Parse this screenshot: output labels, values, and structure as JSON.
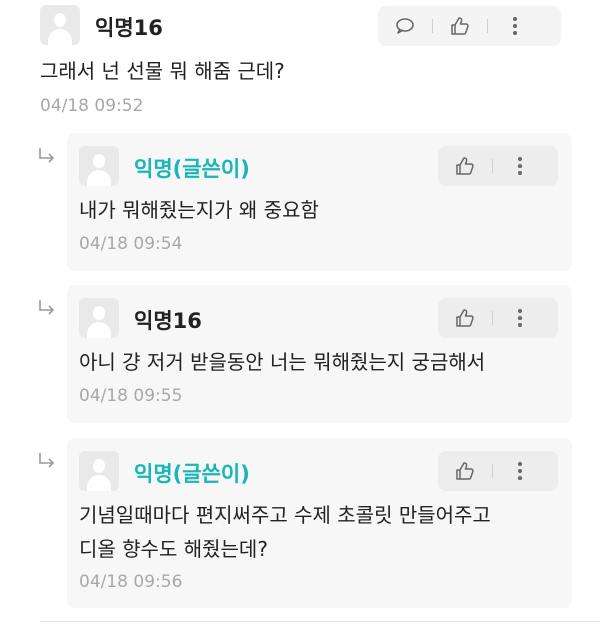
{
  "main_comment": {
    "author": "익명16",
    "text": "그래서 넌 선물 뭐 해줌 근데?",
    "time": "04/18 09:52"
  },
  "replies": [
    {
      "author": "익명(글쓴이)",
      "text": "내가 뭐해줬는지가 왜 중요함",
      "time": "04/18 09:54"
    },
    {
      "author": "익명16",
      "text": "아니 걍 저거 받을동안 너는 뭐해줬는지 궁금해서",
      "time": "04/18 09:55"
    },
    {
      "author": "익명(글쓴이)",
      "text_line1": "기념일때마다 편지써주고 수제 초콜릿 만들어주고",
      "text_line2": "디올 향수도 해줬는데?",
      "time": "04/18 09:56"
    }
  ],
  "icons": {
    "reply": "chat-bubble-icon",
    "like": "thumbs-up-icon",
    "more": "more-vertical-icon",
    "reply_indicator": "reply-arrow-icon"
  },
  "colors": {
    "op_name": "#18b6b6",
    "timestamp": "#a8a8a8",
    "reply_bg": "#f7f7f7"
  }
}
